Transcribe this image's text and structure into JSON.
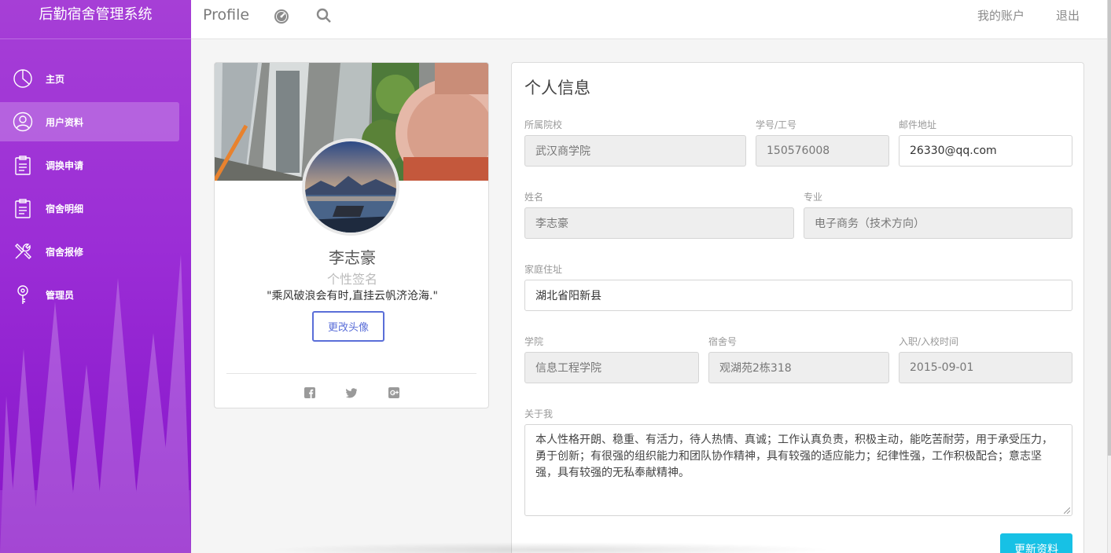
{
  "app": {
    "title": "后勤宿舍管理系统"
  },
  "sidebar": {
    "items": [
      {
        "label": "主页",
        "icon": "pie-chart-icon",
        "active": false
      },
      {
        "label": "用户资料",
        "icon": "user-icon",
        "active": true
      },
      {
        "label": "调换申请",
        "icon": "clipboard-icon",
        "active": false
      },
      {
        "label": "宿舍明细",
        "icon": "clipboard-icon",
        "active": false
      },
      {
        "label": "宿舍报修",
        "icon": "tools-icon",
        "active": false
      },
      {
        "label": "管理员",
        "icon": "key-icon",
        "active": false
      }
    ]
  },
  "topbar": {
    "title": "Profile",
    "account_label": "我的账户",
    "logout_label": "退出"
  },
  "profile": {
    "name": "李志豪",
    "signature_label": "个性签名",
    "quote": "\"乘风破浪会有时,直挂云帆济沧海.\"",
    "change_avatar_label": "更改头像",
    "social": [
      "facebook-icon",
      "twitter-icon",
      "google-plus-icon"
    ]
  },
  "form": {
    "title": "个人信息",
    "school": {
      "label": "所属院校",
      "value": "武汉商学院"
    },
    "student_id": {
      "label": "学号/工号",
      "value": "150576008"
    },
    "email": {
      "label": "邮件地址",
      "value": "26330@qq.com"
    },
    "name": {
      "label": "姓名",
      "value": "李志豪"
    },
    "major": {
      "label": "专业",
      "value": "电子商务（技术方向）"
    },
    "address": {
      "label": "家庭住址",
      "value": "湖北省阳新县"
    },
    "college": {
      "label": "学院",
      "value": "信息工程学院"
    },
    "dorm": {
      "label": "宿舍号",
      "value": "观湖苑2栋318"
    },
    "enroll_date": {
      "label": "入职/入校时间",
      "value": "2015-09-01"
    },
    "about": {
      "label": "关于我",
      "value": "本人性格开朗、稳重、有活力，待人热情、真诚；工作认真负责，积极主动，能吃苦耐劳，用于承受压力，勇于创新；有很强的组织能力和团队协作精神，具有较强的适应能力；纪律性强，工作积极配合；意志坚强，具有较强的无私奉献精神。"
    },
    "submit_label": "更新资料"
  },
  "colors": {
    "sidebar": "#9b2dd6",
    "accent_button": "#17c1e5",
    "outline_button": "#5a6ed8"
  }
}
